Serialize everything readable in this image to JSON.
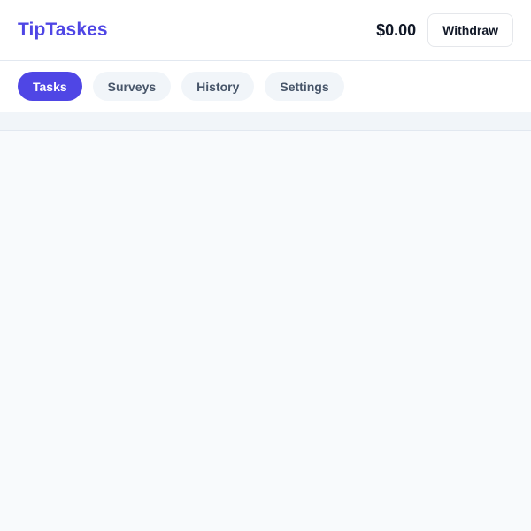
{
  "header": {
    "brand": "TipTaskes",
    "balance": "$0.00",
    "withdraw_label": "Withdraw"
  },
  "tabs": [
    {
      "label": "Tasks",
      "active": true
    },
    {
      "label": "Surveys",
      "active": false
    },
    {
      "label": "History",
      "active": false
    },
    {
      "label": "Settings",
      "active": false
    }
  ],
  "colors": {
    "accent": "#4f46e5",
    "background": "#f8fafc",
    "tab_inactive_bg": "#f1f5f9",
    "tab_inactive_text": "#475569"
  }
}
